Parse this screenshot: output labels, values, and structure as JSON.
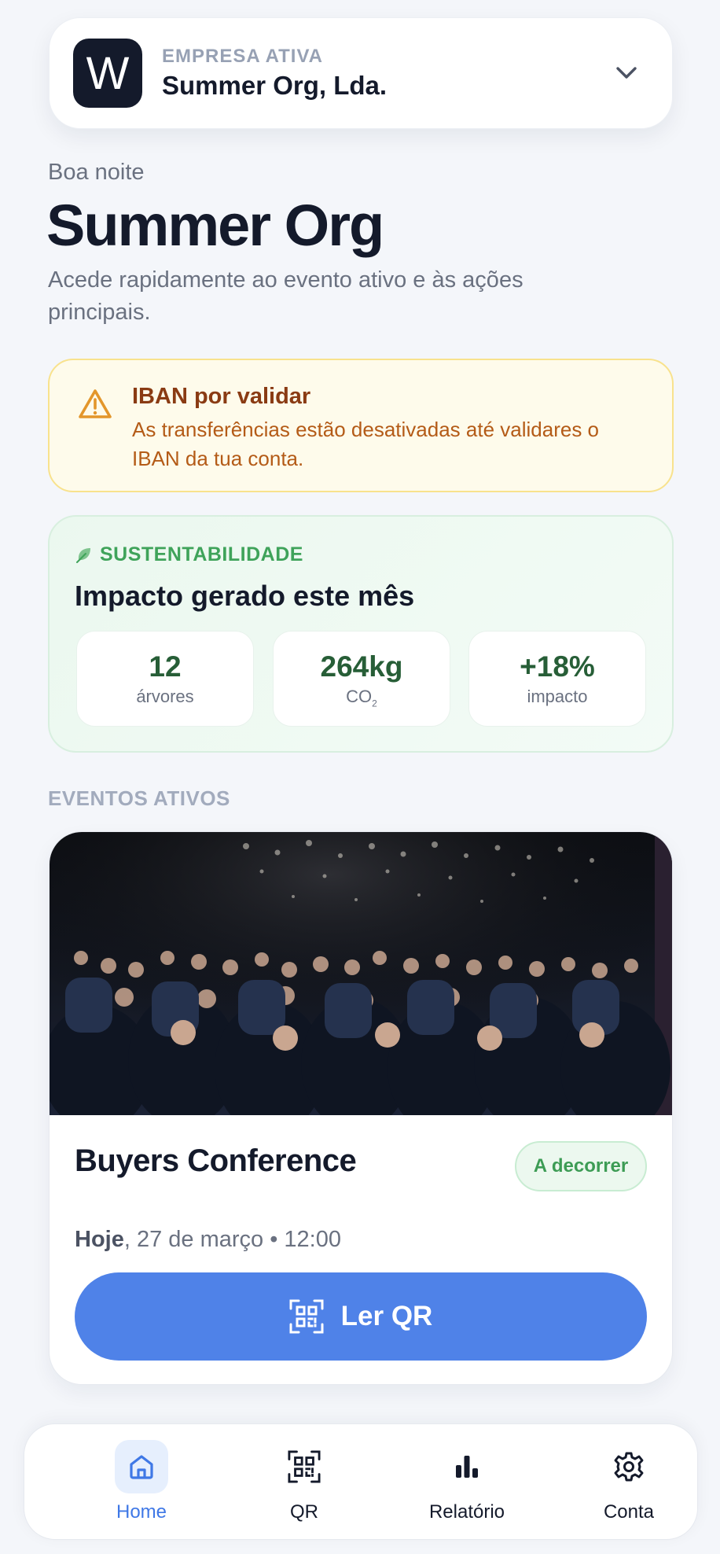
{
  "company": {
    "avatar_letter": "W",
    "caption": "EMPRESA ATIVA",
    "name": "Summer Org, Lda."
  },
  "greeting": "Boa noite",
  "title": "Summer Org",
  "subtitle": "Acede rapidamente ao evento ativo e às ações principais.",
  "warning": {
    "title": "IBAN por validar",
    "body": "As transferências estão desativadas até validares o IBAN da tua conta."
  },
  "sustainability": {
    "label": "SUSTENTABILIDADE",
    "title": "Impacto gerado este mês",
    "stats": [
      {
        "value": "12",
        "label": "árvores"
      },
      {
        "value": "264kg",
        "label": "CO",
        "label_sub": "2"
      },
      {
        "value": "+18%",
        "label": "impacto"
      }
    ]
  },
  "events_section_label": "EVENTOS ATIVOS",
  "event": {
    "title": "Buyers Conference",
    "status": "A decorrer",
    "date_strong": "Hoje",
    "date_rest": ", 27 de março • 12:00",
    "action_label": "Ler QR"
  },
  "nav": {
    "items": [
      {
        "label": "Home",
        "icon": "home-icon",
        "active": true
      },
      {
        "label": "QR",
        "icon": "qr-code-icon"
      },
      {
        "label": "Relatório",
        "icon": "bar-chart-icon"
      },
      {
        "label": "Conta",
        "icon": "gear-icon"
      }
    ]
  },
  "colors": {
    "primary": "#4f82e8",
    "warning_bg": "#fefbeb",
    "eco_green": "#3fa35a",
    "text_dark": "#141a2b"
  }
}
